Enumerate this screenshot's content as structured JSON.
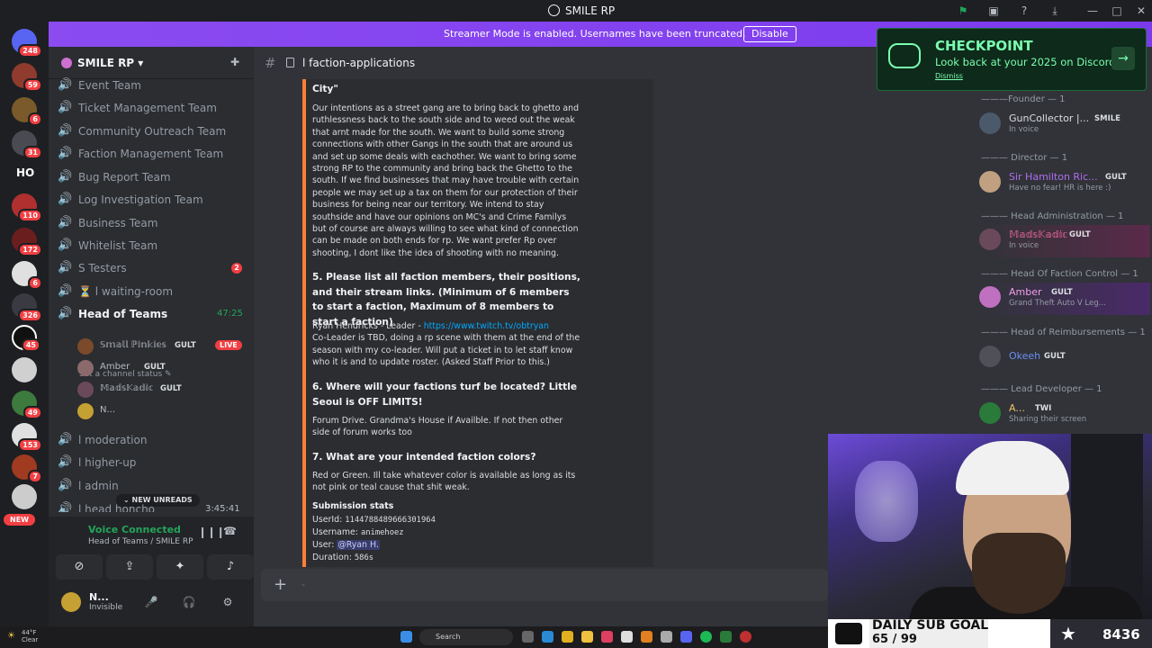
{
  "window": {
    "title": "SMILE RP"
  },
  "banner": {
    "message": "Streamer Mode is enabled. Usernames have been truncated.",
    "button": "Disable"
  },
  "rail": {
    "badges": [
      "248",
      "59",
      "6",
      "31",
      "HO",
      "110",
      "172",
      "6",
      "326",
      "45",
      "49",
      "153",
      "7"
    ],
    "new_label": "NEW"
  },
  "server": {
    "name": "SMILE RP"
  },
  "channels": [
    {
      "label": "Event Team"
    },
    {
      "label": "Ticket Management Team"
    },
    {
      "label": "Community Outreach Team"
    },
    {
      "label": "Faction Management Team"
    },
    {
      "label": "Bug Report Team"
    },
    {
      "label": "Log Investigation Team"
    },
    {
      "label": "Business Team"
    },
    {
      "label": "Whitelist Team"
    },
    {
      "label": "S Testers",
      "badge": "2"
    },
    {
      "label": "⏳ l waiting-room"
    },
    {
      "label": "Head of Teams",
      "timer": "47:25"
    },
    {
      "label": "l moderation"
    },
    {
      "label": "l higher-up"
    },
    {
      "label": "l admin"
    },
    {
      "label": "l head honcho",
      "timer": "3:45:41"
    }
  ],
  "channel_status": "Set a channel status",
  "voice_users": [
    {
      "name": "𝕊𝕞𝕒𝕝𝕝 ℙ𝕚𝕟𝕜𝕚𝕖𝕤",
      "tag": "GULT",
      "live": "LIVE"
    },
    {
      "name": "Amber",
      "tag": "GULT"
    },
    {
      "name": "𝕄𝕒𝕕𝕤𝕂𝕒𝕕𝕚𝕔",
      "tag": "GULT"
    },
    {
      "name": "N..."
    }
  ],
  "new_unreads": "NEW UNREADS",
  "voice_panel": {
    "status": "Voice Connected",
    "location": "Head of Teams / SMILE RP"
  },
  "user_panel": {
    "name": "N...",
    "status": "Invisible"
  },
  "chat": {
    "channel_name": "l faction-applications",
    "top_fragment": "City\"",
    "intent_paragraph": "Our intentions as a street gang are to bring back to ghetto and ruthlessness back to the south side and to weed out the weak that arnt made for the south. We want to build some strong connections with other Gangs in the south that are around us and set up some deals with eachother. We want to bring some strong RP to the community and bring back the Ghetto to the south. If we find businesses that may have trouble with certain people we may set up a tax on them for our protection of their business for being near our territory. We intend to stay southside and have our opinions on MC's and Crime Familys but of course are always willing to see what kind of connection can be made on both ends for rp. We want prefer Rp over shooting, I dont like the idea of shooting with no meaning.",
    "q5": "5. Please list all faction members, their positions, and their stream links. (Minimum of 6 members to start a faction, Maximum of 8 members to start a faction)",
    "a5_prefix": "Ryan Hendricks - Leader - ",
    "a5_link": "https://www.twitch.tv/obtryan",
    "a5_rest": "Co-Leader is TBD, doing a rp scene with them at the end of the season with my co-leader. Will put a ticket in to let staff know who it is and to update roster. (Asked Staff Prior to this.)",
    "q6": "6. Where will your factions turf be located? Little Seoul is OFF LIMITS!",
    "a6": "Forum Drive. Grandma's House if Availble. If not then other side of forum works too",
    "q7": "7. What are your intended faction colors?",
    "a7": "Red or Green. Ill take whatever color is available as long as its not pink or teal cause that shit weak.",
    "stats_title": "Submission stats",
    "userid_label": "UserId:",
    "userid_value": "1144788489666301964",
    "username_label": "Username:",
    "username_value": "animehoez",
    "user_label": "User:",
    "user_value": "@Ryan H.",
    "duration_label": "Duration:",
    "duration_value": "586s",
    "composer_placeholder": "-"
  },
  "checkpoint": {
    "title": "CHECKPOINT",
    "subtitle": "Look back at your 2025 on Discord",
    "dismiss": "Dismiss"
  },
  "members": {
    "roles": [
      "———Founder — 1",
      "——— Director — 1",
      "——— Head Administration — 1",
      "——— Head Of Faction Control — 1",
      "——— Head of Reimbursements — 1",
      "——— Lead Developer — 1"
    ],
    "list": [
      {
        "name": "GunCollector |...",
        "tag": "SMILE",
        "sub": "In voice",
        "color": "#dbdee1"
      },
      {
        "name": "Sir Hamilton Ric...",
        "tag": "GULT",
        "sub": "Have no fear! HR is here :)",
        "color": "#b06cf2"
      },
      {
        "name": "𝕄𝕒𝕕𝕤𝕂𝕒𝕕𝕚𝕔",
        "tag": "GULT",
        "sub": "In voice",
        "color": "#f26ba0"
      },
      {
        "name": "Amber",
        "tag": "GULT",
        "sub": "Grand Theft Auto V Leg...",
        "color": "#f0a0e8"
      },
      {
        "name": "Okeeh",
        "tag": "GULT",
        "sub": "",
        "color": "#6b8ef2"
      },
      {
        "name": "A...",
        "tag": "TWI",
        "sub": "Sharing their screen",
        "color": "#f2c26b"
      }
    ]
  },
  "overlay": {
    "goal_label": "DAILY SUB GOAL",
    "goal_count": "65 / 99",
    "goal_progress": 0.657,
    "total": "8436"
  },
  "taskbar": {
    "temp": "44°F",
    "condition": "Clear",
    "search": "Search"
  }
}
